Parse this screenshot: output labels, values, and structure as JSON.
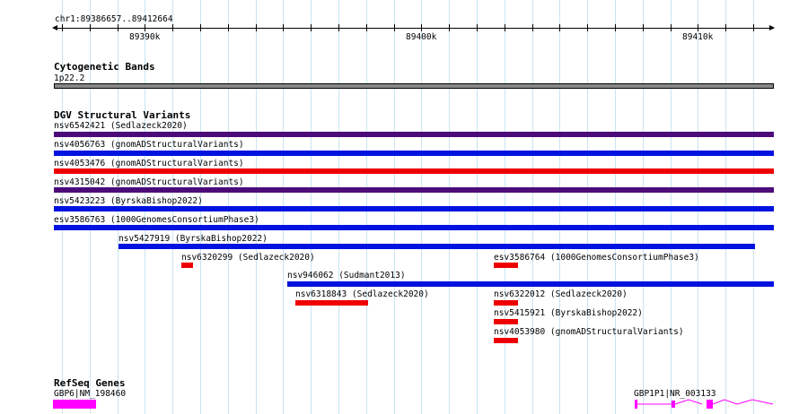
{
  "ruler": {
    "location": "chr1:89386657..89412664",
    "tick_labels": [
      "89390k",
      "89400k",
      "89410k"
    ]
  },
  "tracks": {
    "cytoband": {
      "title": "Cytogenetic Bands",
      "band_label": "1p22.2",
      "band_color": "#888888"
    },
    "dgv": {
      "title": "DGV Structural Variants",
      "features": [
        {
          "label": "nsv6542421 (Sedlazeck2020)",
          "color": "#4b0c7a"
        },
        {
          "label": "nsv4056763 (gnomADStructuralVariants)",
          "color": "#0012e0"
        },
        {
          "label": "nsv4053476 (gnomADStructuralVariants)",
          "color": "#ee0000"
        },
        {
          "label": "nsv4315042 (gnomADStructuralVariants)",
          "color": "#4b0c7a"
        },
        {
          "label": "nsv5423223 (ByrskaBishop2022)",
          "color": "#0012e0"
        },
        {
          "label": "esv3586763 (1000GenomesConsortiumPhase3)",
          "color": "#0012e0"
        },
        {
          "label": "nsv5427919 (ByrskaBishop2022)",
          "color": "#0012e0"
        },
        {
          "label": "nsv6320299 (Sedlazeck2020)",
          "color": "#ee0000"
        },
        {
          "label": "esv3586764 (1000GenomesConsortiumPhase3)",
          "color": "#ee0000"
        },
        {
          "label": "nsv946062 (Sudmant2013)",
          "color": "#0012e0"
        },
        {
          "label": "nsv6318843 (Sedlazeck2020)",
          "color": "#ee0000"
        },
        {
          "label": "nsv6322012 (Sedlazeck2020)",
          "color": "#ee0000"
        },
        {
          "label": "nsv5415921 (ByrskaBishop2022)",
          "color": "#ee0000"
        },
        {
          "label": "nsv4053980 (gnomADStructuralVariants)",
          "color": "#ee0000"
        }
      ]
    },
    "refseq": {
      "title": "RefSeq Genes",
      "genes": [
        {
          "label": "GBP6|NM_198460",
          "color": "#ff00ff"
        },
        {
          "label": "GBP1P1|NR_003133",
          "color": "#ff00ff"
        }
      ]
    }
  }
}
